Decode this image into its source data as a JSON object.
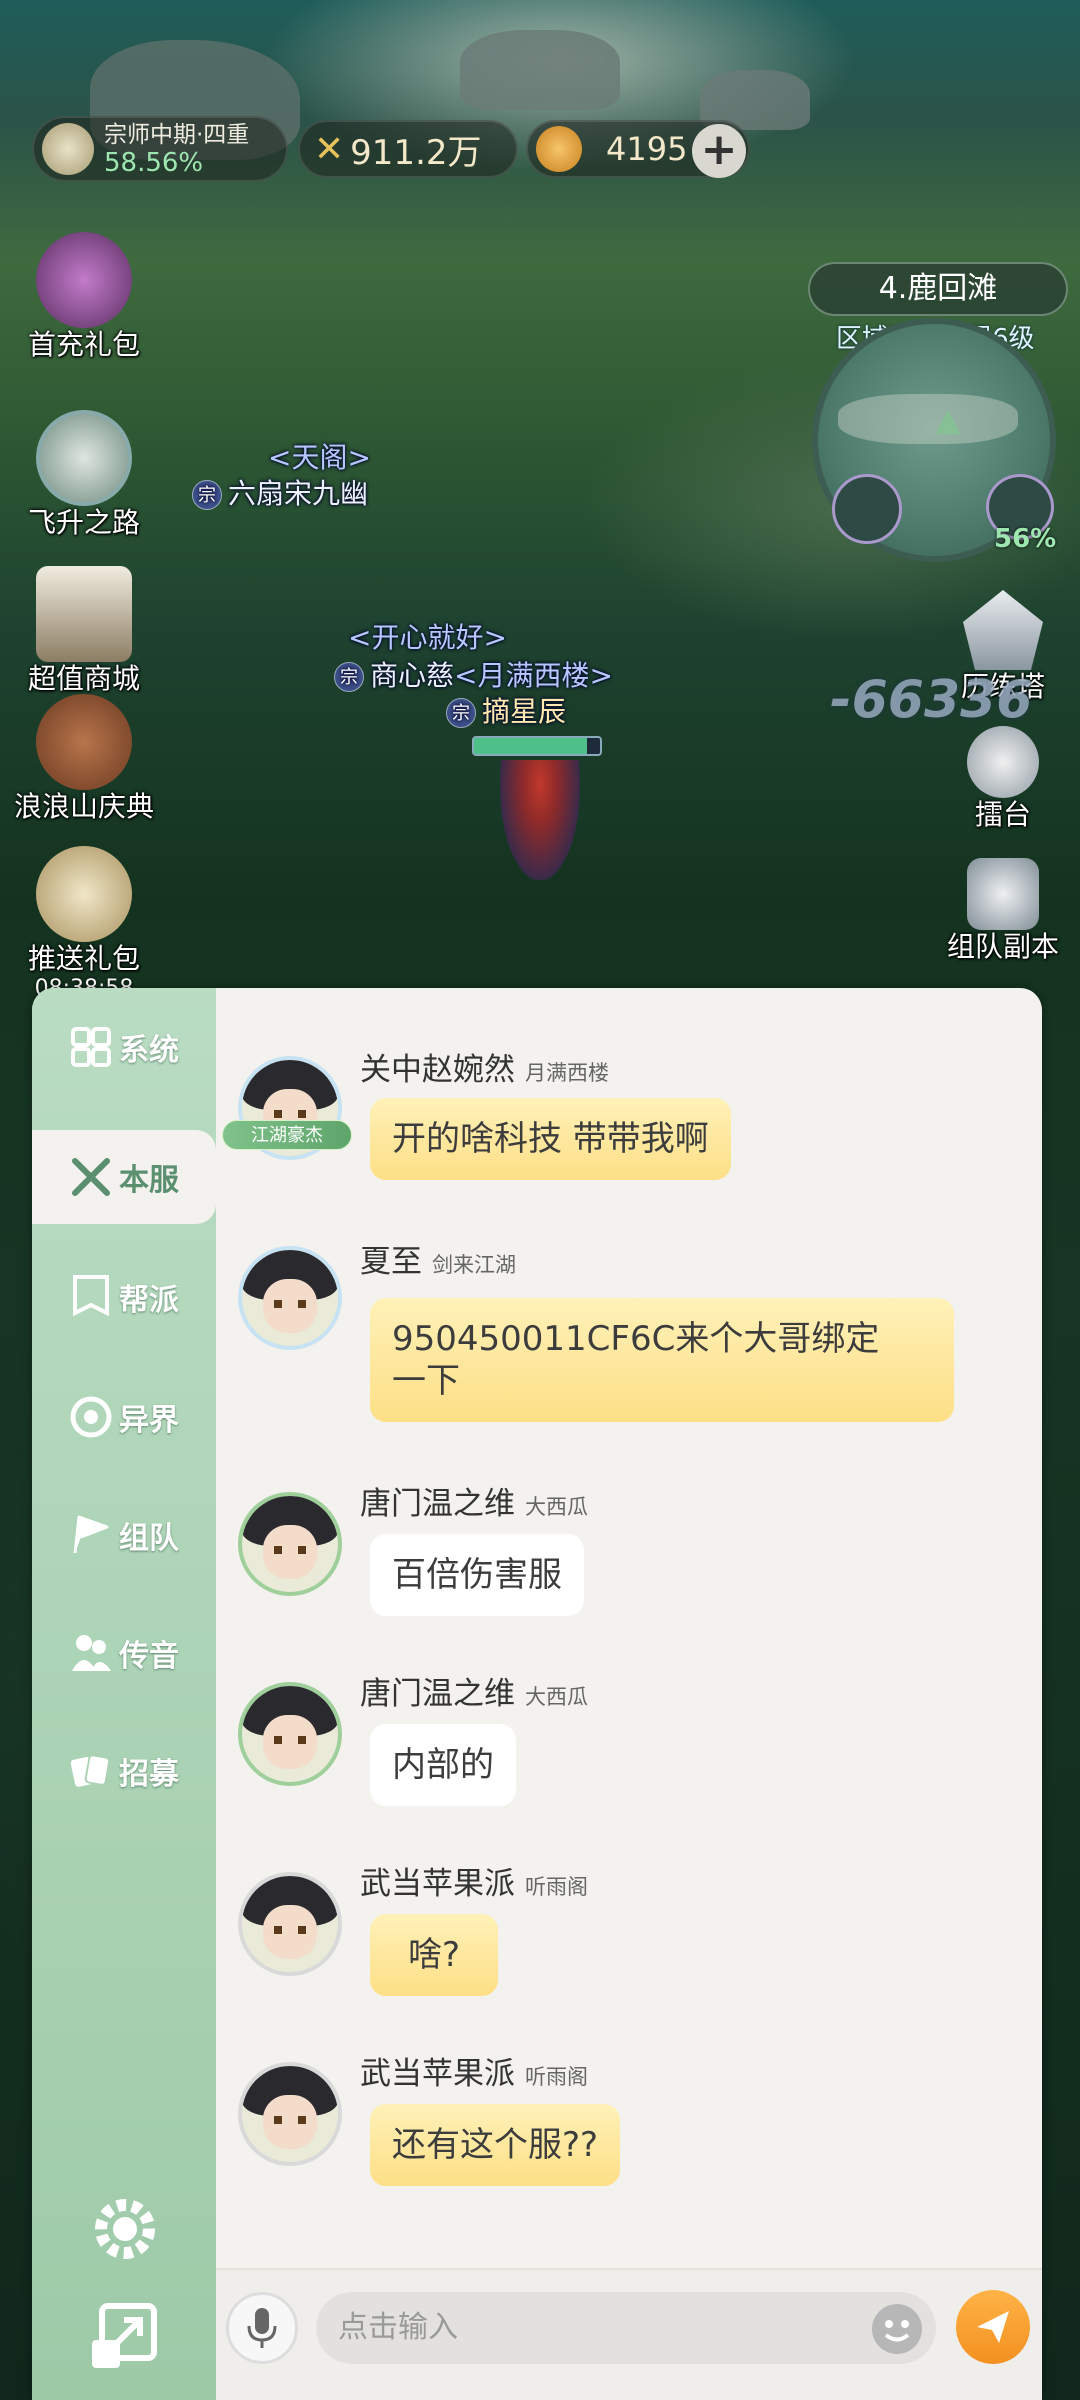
{
  "hud": {
    "level_line1": "宗师中期·四重",
    "level_line2": "58.56%",
    "power_value": "911.2万",
    "currency_value": "4195",
    "add_label": "+"
  },
  "left_menu": [
    {
      "label": "首充礼包"
    },
    {
      "label": "飞升之路"
    },
    {
      "label": "超值商城"
    },
    {
      "label": "浪浪山庆典"
    },
    {
      "label": "推送礼包",
      "timer": "08:38:58"
    }
  ],
  "right_menu": [
    {
      "label": "历练塔"
    },
    {
      "label": "擂台"
    },
    {
      "label": "组队副本"
    }
  ],
  "minimap": {
    "area_name": "4.鹿回滩",
    "reputation_cap": "区域声望上限6级",
    "percent": "56%"
  },
  "world": {
    "player1_guild": "<天阁>",
    "player1_name": "六扇宋九幽",
    "player2_guild": "<开心就好>",
    "player2_name": "商心慈",
    "player3_guild": "<月满西楼>",
    "player3_name": "摘星辰",
    "damage_number": "-66336",
    "sect_badge": "宗"
  },
  "chat_tabs": [
    {
      "label": "系统"
    },
    {
      "label": "本服"
    },
    {
      "label": "帮派"
    },
    {
      "label": "异界"
    },
    {
      "label": "组队"
    },
    {
      "label": "传音"
    },
    {
      "label": "招募"
    }
  ],
  "messages": [
    {
      "name": "关中赵婉然",
      "guild": "月满西楼",
      "text": "开的啥科技 带带我啊",
      "title_tag": "江湖豪杰"
    },
    {
      "name": "夏至",
      "guild": "剑来江湖",
      "text_line1": "950450011CF6C来个大哥绑定",
      "text_line2": "一下"
    },
    {
      "name": "唐门温之维",
      "guild": "大西瓜",
      "text": "百倍伤害服"
    },
    {
      "name": "唐门温之维",
      "guild": "大西瓜",
      "text": "内部的"
    },
    {
      "name": "武当苹果派",
      "guild": "听雨阁",
      "text": "啥?"
    },
    {
      "name": "武当苹果派",
      "guild": "听雨阁",
      "text": "还有这个服??"
    }
  ],
  "input": {
    "placeholder": "点击输入"
  },
  "colors": {
    "panel_bg": "#f4f2ef",
    "sidebar": "#a9d2b3",
    "bubble_gold": "#fddf86",
    "send_button": "#f39020"
  }
}
